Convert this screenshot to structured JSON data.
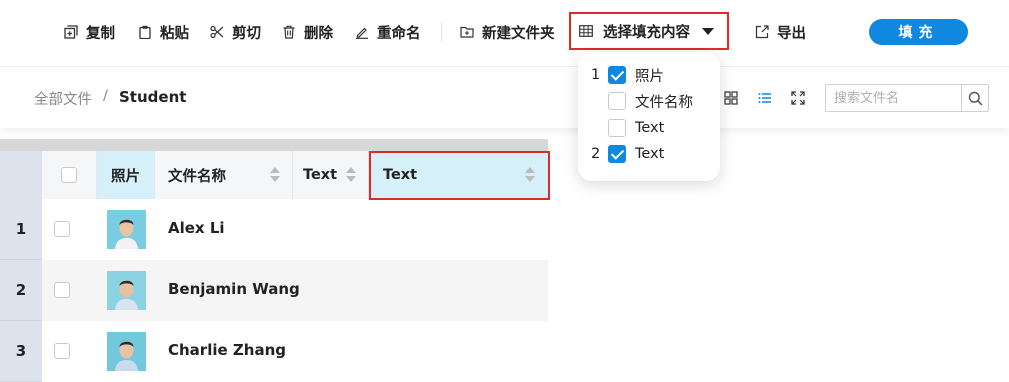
{
  "toolbar": {
    "copy_label": "复制",
    "paste_label": "粘贴",
    "cut_label": "剪切",
    "delete_label": "删除",
    "rename_label": "重命名",
    "new_folder_label": "新建文件夹",
    "select_fill_label": "选择填充内容",
    "export_label": "导出",
    "fill_label": "填充"
  },
  "breadcrumb": {
    "root": "全部文件",
    "separator": "/",
    "current": "Student"
  },
  "search": {
    "placeholder": "搜索文件名"
  },
  "grid": {
    "headers": {
      "photo": "照片",
      "filename": "文件名称",
      "text1": "Text",
      "text2": "Text"
    },
    "rows": [
      {
        "num": "1",
        "name": "Alex Li"
      },
      {
        "num": "2",
        "name": "Benjamin Wang"
      },
      {
        "num": "3",
        "name": "Charlie Zhang"
      }
    ]
  },
  "fill_menu": {
    "items": [
      {
        "order": "1",
        "label": "照片",
        "checked": true
      },
      {
        "order": "",
        "label": "文件名称",
        "checked": false
      },
      {
        "order": "",
        "label": "Text",
        "checked": false
      },
      {
        "order": "2",
        "label": "Text",
        "checked": true
      }
    ]
  },
  "colors": {
    "accent": "#1188e0",
    "highlight_border": "#e02a2a",
    "row_number_bg": "#dde3ec",
    "selected_header_bg": "#d6f0fa"
  }
}
